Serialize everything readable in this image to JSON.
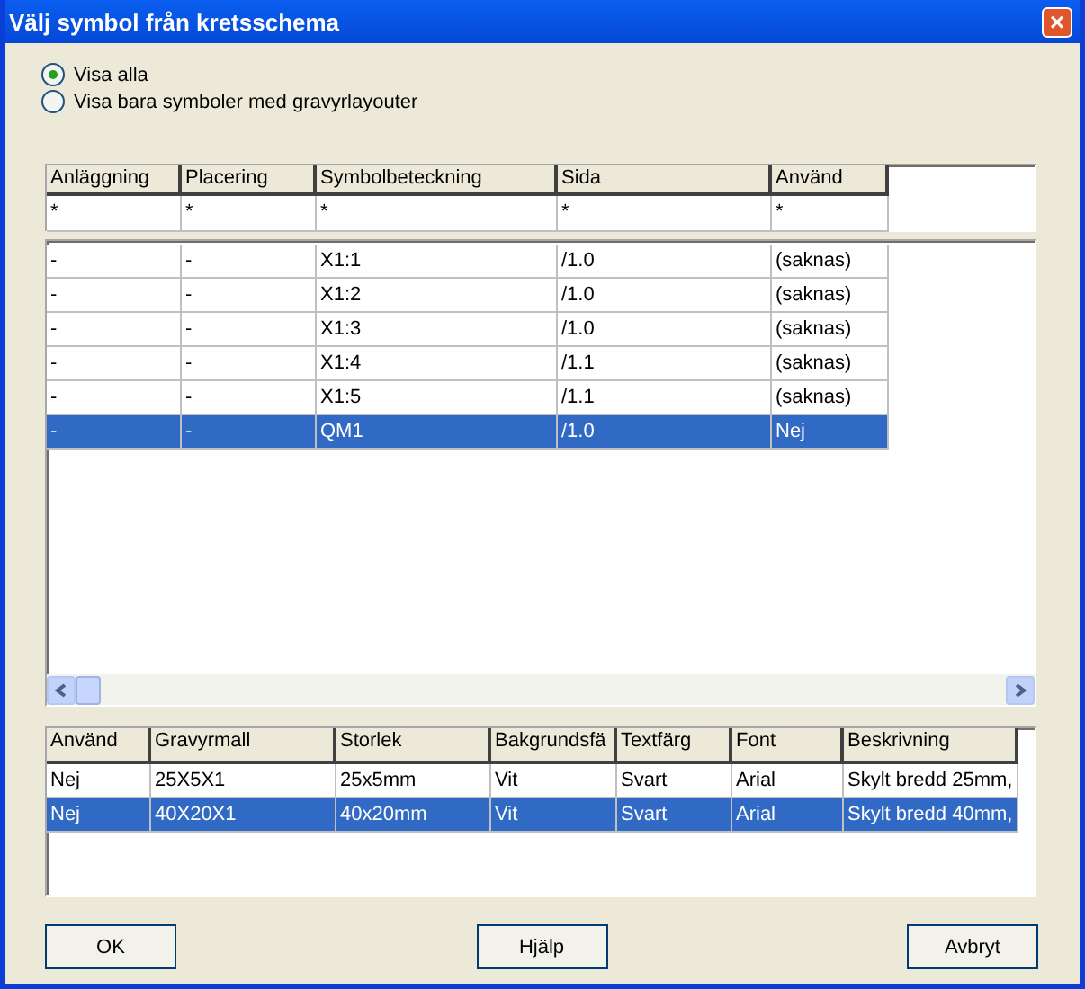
{
  "window": {
    "title": "Välj symbol från kretsschema",
    "close": "×"
  },
  "view_options": [
    {
      "label": "Visa alla",
      "selected": true
    },
    {
      "label": "Visa bara symboler med gravyrlayouter",
      "selected": false
    }
  ],
  "symbol_table": {
    "columns": [
      "Anläggning",
      "Placering",
      "Symbolbeteckning",
      "Sida",
      "Använd"
    ],
    "filters": [
      "*",
      "*",
      "*",
      "*",
      "*"
    ],
    "rows": [
      {
        "cells": [
          "-",
          "-",
          "X1:1",
          "/1.0",
          "(saknas)"
        ],
        "selected": false
      },
      {
        "cells": [
          "-",
          "-",
          "X1:2",
          "/1.0",
          "(saknas)"
        ],
        "selected": false
      },
      {
        "cells": [
          "-",
          "-",
          "X1:3",
          "/1.0",
          "(saknas)"
        ],
        "selected": false
      },
      {
        "cells": [
          "-",
          "-",
          "X1:4",
          "/1.1",
          "(saknas)"
        ],
        "selected": false
      },
      {
        "cells": [
          "-",
          "-",
          "X1:5",
          "/1.1",
          "(saknas)"
        ],
        "selected": false
      },
      {
        "cells": [
          "-",
          "-",
          "QM1",
          "/1.0",
          "Nej"
        ],
        "selected": true
      }
    ]
  },
  "layout_table": {
    "columns": [
      "Använd",
      "Gravyrmall",
      "Storlek",
      "Bakgrundsfä",
      "Textfärg",
      "Font",
      "Beskrivning"
    ],
    "rows": [
      {
        "cells": [
          "Nej",
          "25X5X1",
          "25x5mm",
          "Vit",
          "Svart",
          "Arial",
          "Skylt bredd 25mm,"
        ],
        "selected": false
      },
      {
        "cells": [
          "Nej",
          "40X20X1",
          "40x20mm",
          "Vit",
          "Svart",
          "Arial",
          "Skylt bredd 40mm,"
        ],
        "selected": true
      }
    ]
  },
  "buttons": [
    "OK",
    "Hjälp",
    "Avbryt"
  ]
}
